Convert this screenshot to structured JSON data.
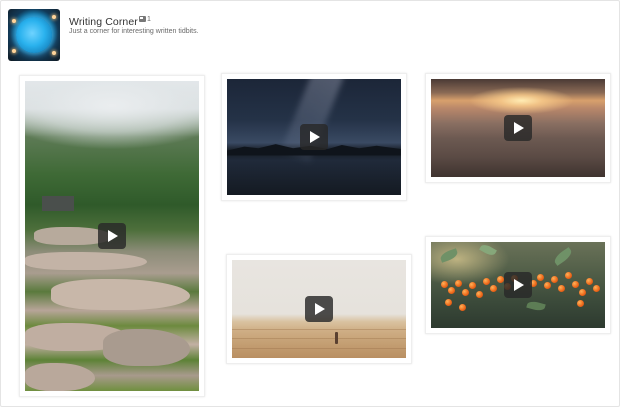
{
  "feed": {
    "title": "Writing Corner",
    "post_count": "1",
    "description": "Just a corner for interesting written tidbits.",
    "avatar_icon": "glowing-orb-avatar"
  },
  "videos": [
    {
      "name": "video-rice-terraces",
      "play_icon": "play-icon"
    },
    {
      "name": "video-night-sky-lake",
      "play_icon": "play-icon"
    },
    {
      "name": "video-sunrise-fog",
      "play_icon": "play-icon"
    },
    {
      "name": "video-desert-walker",
      "play_icon": "play-icon"
    },
    {
      "name": "video-orange-berries",
      "play_icon": "play-icon"
    }
  ],
  "colors": {
    "title_text": "#333333",
    "description_text": "#6a6a6a",
    "card_border": "#eeeeee",
    "play_button_bg": "#282828"
  }
}
